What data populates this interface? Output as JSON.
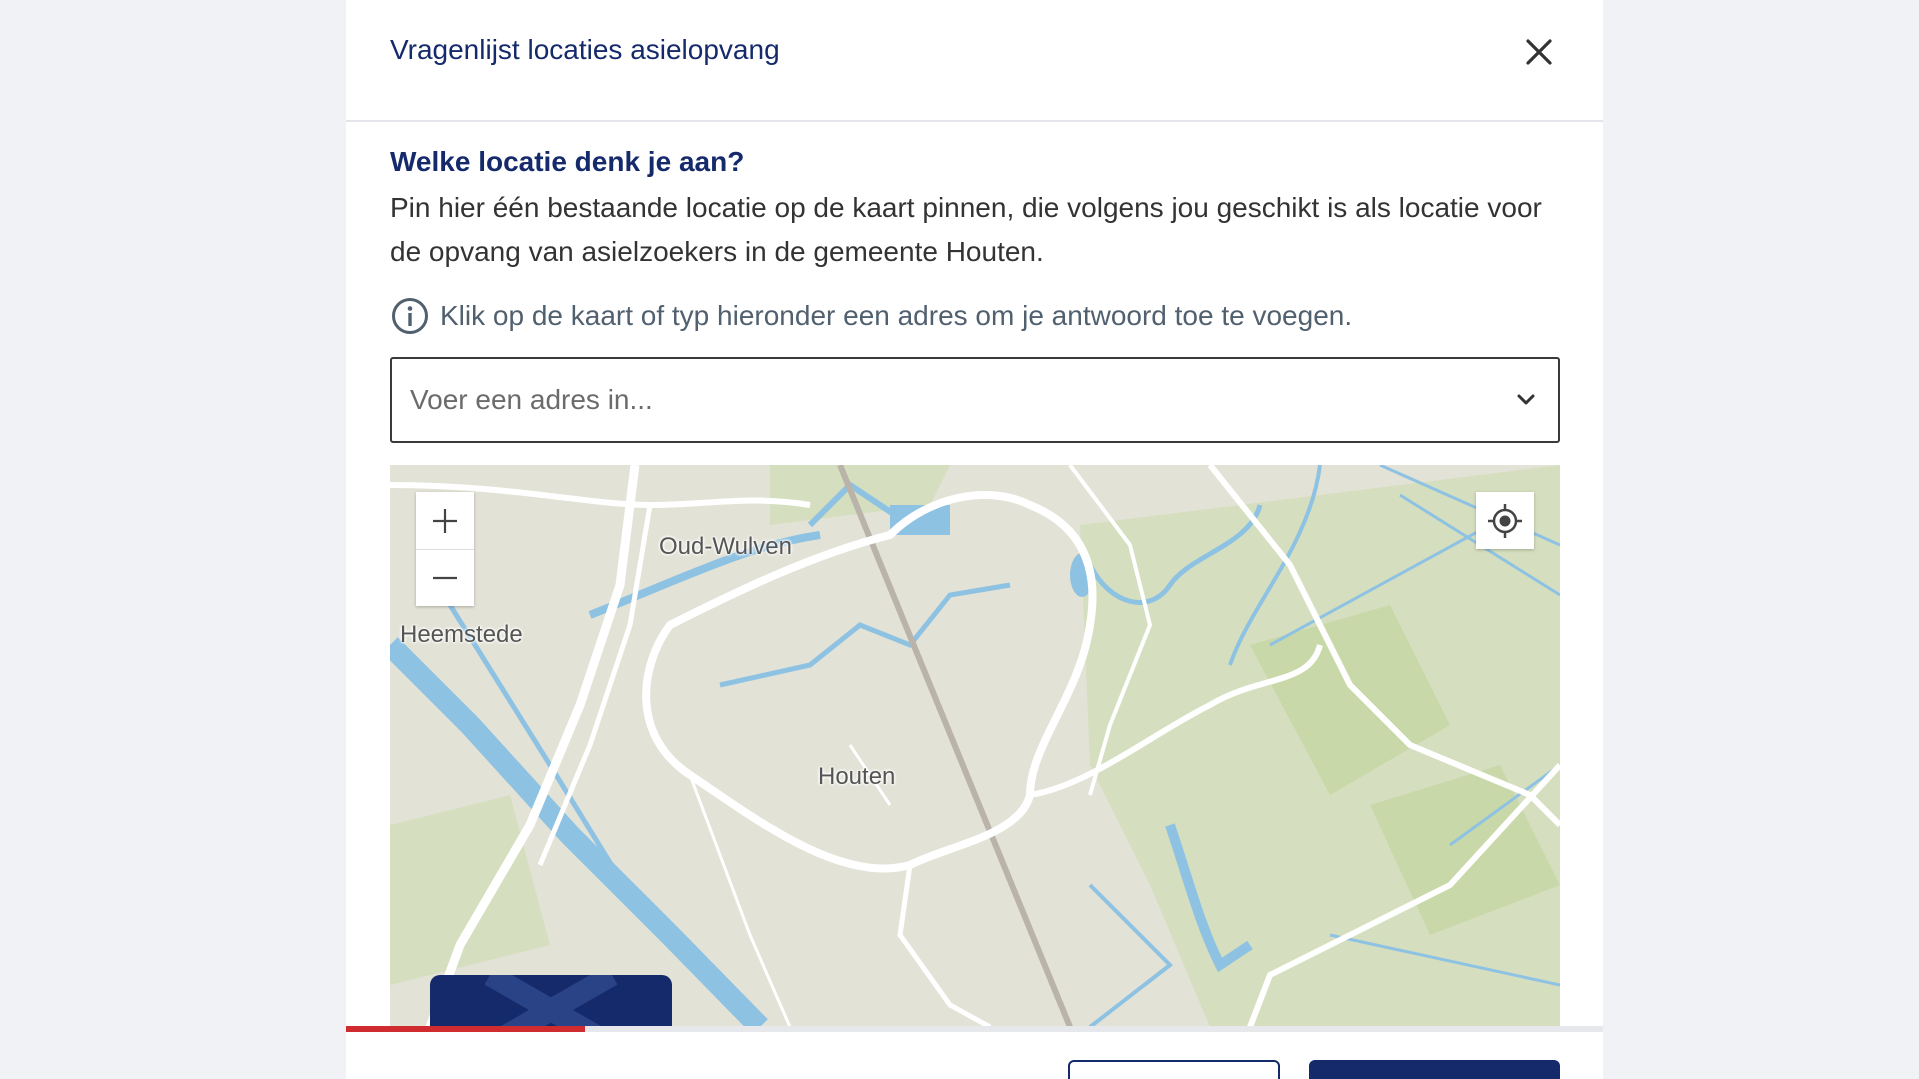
{
  "modal": {
    "title": "Vragenlijst locaties asielopvang",
    "question": "Welke locatie denk je aan?",
    "description": "Pin hier één bestaande locatie op de kaart pinnen, die volgens jou geschikt is als locatie voor de opvang van asielzoekers in de gemeente Houten.",
    "hint": "Klik op de kaart of typ hieronder een adres om je antwoord toe te voegen.",
    "address_placeholder": "Voer een adres in..."
  },
  "map": {
    "labels": {
      "oud_wulven": "Oud-Wulven",
      "heemstede": "Heemstede",
      "houten": "Houten"
    }
  },
  "progress": {
    "fraction": 0.19
  },
  "colors": {
    "brand": "#152a6b",
    "progress": "#d02c2f",
    "water": "#8ec2e3",
    "green": "#cfdcb5"
  },
  "icons": {
    "close": "close-icon",
    "info": "info-icon",
    "chevron": "chevron-down-icon",
    "zoom_in": "plus-icon",
    "zoom_out": "minus-icon",
    "locate": "crosshair-icon"
  }
}
